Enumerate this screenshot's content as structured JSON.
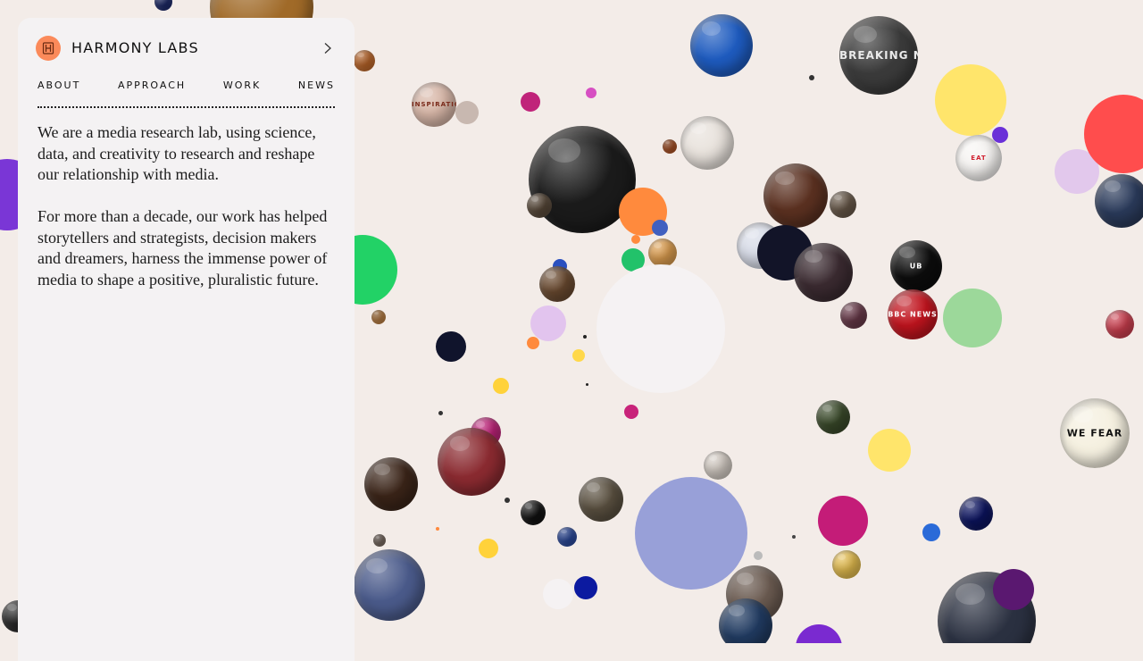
{
  "brand": {
    "logo_letter": "H",
    "name": "HARMONY LABS",
    "accent": "#fb8a5a"
  },
  "nav": {
    "items": [
      {
        "label": "ABOUT"
      },
      {
        "label": "APPROACH"
      },
      {
        "label": "WORK"
      },
      {
        "label": "NEWS"
      }
    ]
  },
  "about": {
    "paragraphs": [
      "We are a media research lab, using science, data, and creativity to research and reshape our relationship with media.",
      "For more than a decade, our work has helped storytellers and strategists, decision makers and dreamers, harness the immense power of media to shape a positive, pluralistic future."
    ]
  },
  "bubble_labels": {
    "breaking_news": "BREAKING NEWS",
    "bbc_news": "BBC NEWS",
    "eat": "EAT",
    "ub": "UB",
    "inspiration": "INSPIRATION",
    "we_fear": "WE FEAR"
  },
  "icons": {
    "chevron": "chevron-right-icon"
  }
}
